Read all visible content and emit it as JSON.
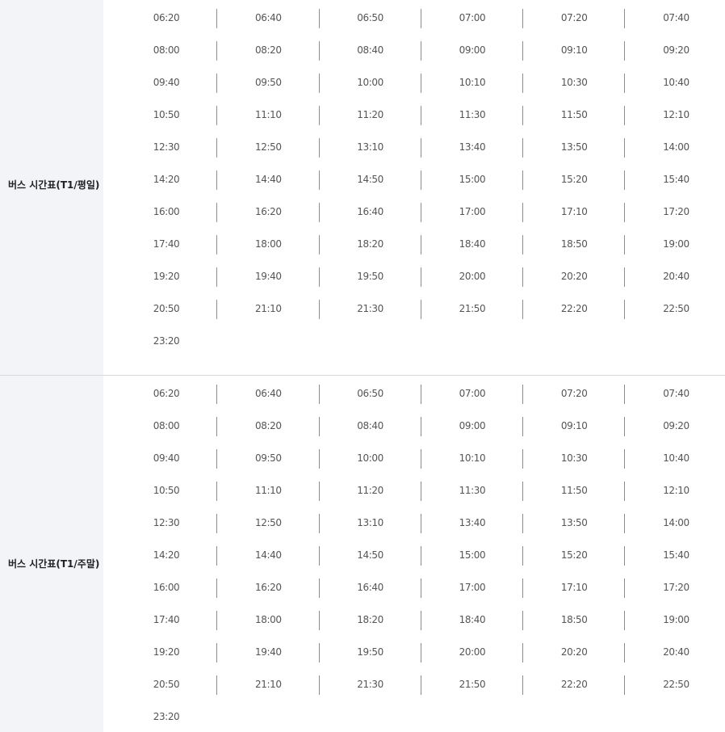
{
  "timetables": [
    {
      "label": "버스 시간표(T1/평일)",
      "rows": [
        [
          "06:20",
          "06:40",
          "06:50",
          "07:00",
          "07:20",
          "07:40"
        ],
        [
          "08:00",
          "08:20",
          "08:40",
          "09:00",
          "09:10",
          "09:20"
        ],
        [
          "09:40",
          "09:50",
          "10:00",
          "10:10",
          "10:30",
          "10:40"
        ],
        [
          "10:50",
          "11:10",
          "11:20",
          "11:30",
          "11:50",
          "12:10"
        ],
        [
          "12:30",
          "12:50",
          "13:10",
          "13:40",
          "13:50",
          "14:00"
        ],
        [
          "14:20",
          "14:40",
          "14:50",
          "15:00",
          "15:20",
          "15:40"
        ],
        [
          "16:00",
          "16:20",
          "16:40",
          "17:00",
          "17:10",
          "17:20"
        ],
        [
          "17:40",
          "18:00",
          "18:20",
          "18:40",
          "18:50",
          "19:00"
        ],
        [
          "19:20",
          "19:40",
          "19:50",
          "20:00",
          "20:20",
          "20:40"
        ],
        [
          "20:50",
          "21:10",
          "21:30",
          "21:50",
          "22:20",
          "22:50"
        ],
        [
          "23:20"
        ]
      ]
    },
    {
      "label": "버스 시간표(T1/주말)",
      "rows": [
        [
          "06:20",
          "06:40",
          "06:50",
          "07:00",
          "07:20",
          "07:40"
        ],
        [
          "08:00",
          "08:20",
          "08:40",
          "09:00",
          "09:10",
          "09:20"
        ],
        [
          "09:40",
          "09:50",
          "10:00",
          "10:10",
          "10:30",
          "10:40"
        ],
        [
          "10:50",
          "11:10",
          "11:20",
          "11:30",
          "11:50",
          "12:10"
        ],
        [
          "12:30",
          "12:50",
          "13:10",
          "13:40",
          "13:50",
          "14:00"
        ],
        [
          "14:20",
          "14:40",
          "14:50",
          "15:00",
          "15:20",
          "15:40"
        ],
        [
          "16:00",
          "16:20",
          "16:40",
          "17:00",
          "17:10",
          "17:20"
        ],
        [
          "17:40",
          "18:00",
          "18:20",
          "18:40",
          "18:50",
          "19:00"
        ],
        [
          "19:20",
          "19:40",
          "19:50",
          "20:00",
          "20:20",
          "20:40"
        ],
        [
          "20:50",
          "21:10",
          "21:30",
          "21:50",
          "22:20",
          "22:50"
        ],
        [
          "23:20"
        ]
      ]
    }
  ],
  "colors": {
    "label_background": "#f3f4f8",
    "separator": "#8c8c8c",
    "divider": "#d8d8d8",
    "time_text": "#555555"
  }
}
